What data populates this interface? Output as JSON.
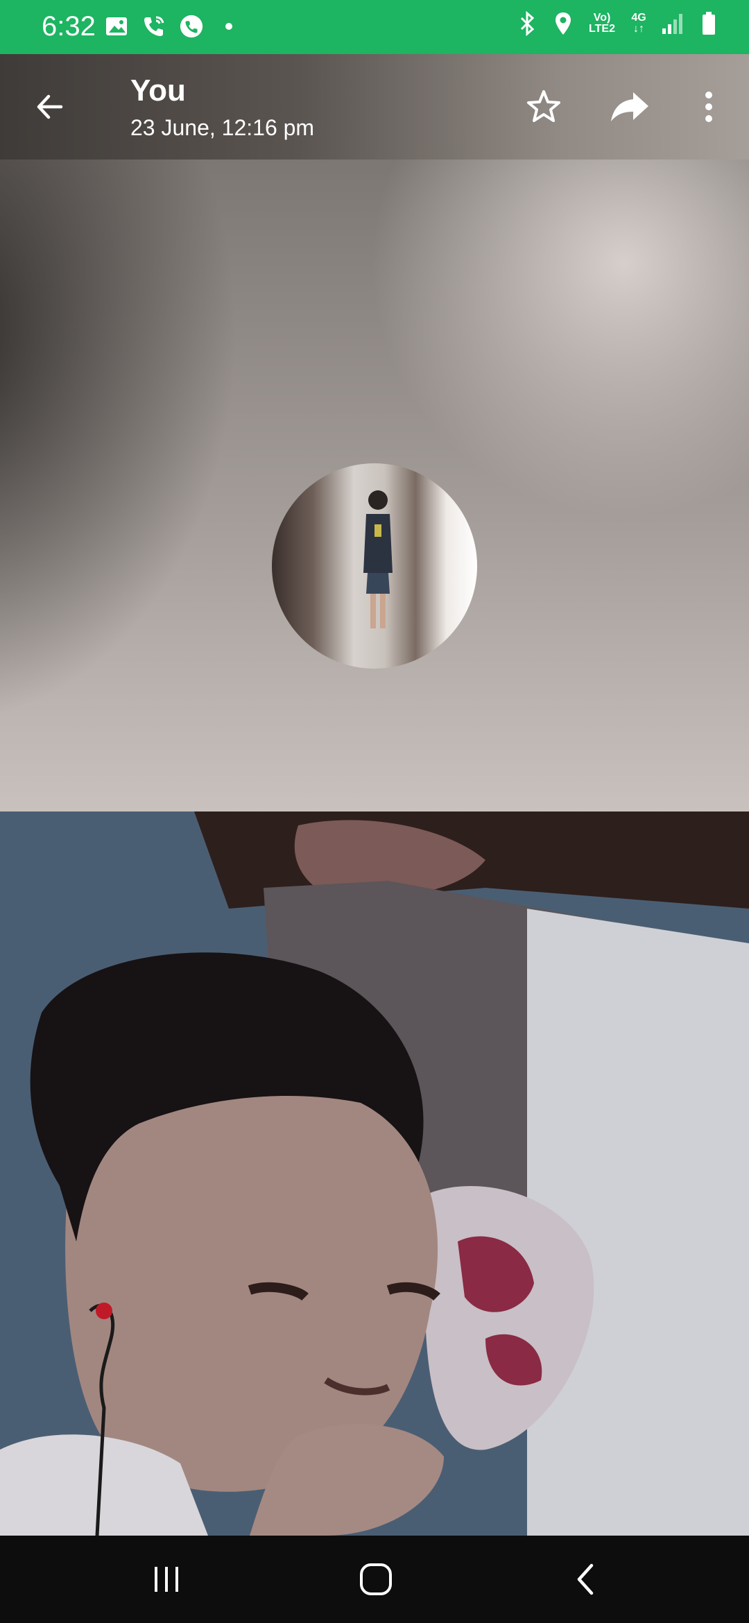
{
  "status_bar": {
    "time": "6:32",
    "network_label_top": "Vo)",
    "network_label_bottom": "LTE2",
    "network_type": "4G",
    "icons": [
      "gallery-icon",
      "wifi-call-icon",
      "whatsapp-icon",
      "dot-icon",
      "bluetooth-icon",
      "location-icon",
      "signal-icon",
      "battery-icon"
    ]
  },
  "app_bar": {
    "title": "You",
    "subtitle": "23 June, 12:16 pm",
    "icons": [
      "back-arrow-icon",
      "star-icon",
      "forward-icon",
      "more-vert-icon"
    ]
  },
  "nav_bar": {
    "icons": [
      "recent-apps-icon",
      "home-icon",
      "back-icon"
    ]
  },
  "colors": {
    "status_bar_bg": "#1db462",
    "text": "#ffffff"
  }
}
